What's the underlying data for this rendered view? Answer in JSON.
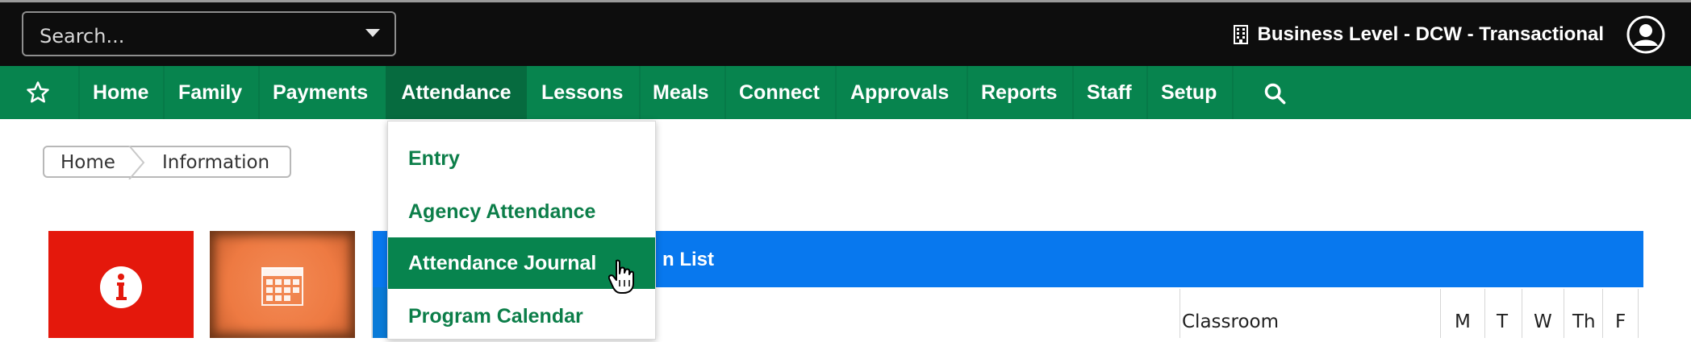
{
  "topbar": {
    "search_placeholder": "Search...",
    "business_label": "Business Level - DCW - Transactional"
  },
  "nav": {
    "items": [
      {
        "label": "Home"
      },
      {
        "label": "Family"
      },
      {
        "label": "Payments"
      },
      {
        "label": "Attendance"
      },
      {
        "label": "Lessons"
      },
      {
        "label": "Meals"
      },
      {
        "label": "Connect"
      },
      {
        "label": "Approvals"
      },
      {
        "label": "Reports"
      },
      {
        "label": "Staff"
      },
      {
        "label": "Setup"
      }
    ],
    "active": "Attendance"
  },
  "breadcrumb": {
    "home": "Home",
    "current": "Information"
  },
  "dropdown": {
    "items": [
      {
        "label": "Entry"
      },
      {
        "label": "Agency Attendance"
      },
      {
        "label": "Attendance Journal"
      },
      {
        "label": "Program Calendar"
      }
    ],
    "highlighted": "Attendance Journal"
  },
  "panel": {
    "title_visible": "n List",
    "columns": {
      "classroom": "Classroom",
      "days": [
        "M",
        "T",
        "W",
        "Th",
        "F"
      ]
    }
  },
  "colors": {
    "nav_green": "#07844e",
    "panel_blue": "#0878ee",
    "tile_red": "#e4180c",
    "tile_orange": "#ee7a42"
  },
  "icons": [
    "building-icon",
    "user-avatar-icon",
    "star-icon",
    "search-icon",
    "info-icon",
    "calendar-icon",
    "hand-cursor-icon"
  ]
}
